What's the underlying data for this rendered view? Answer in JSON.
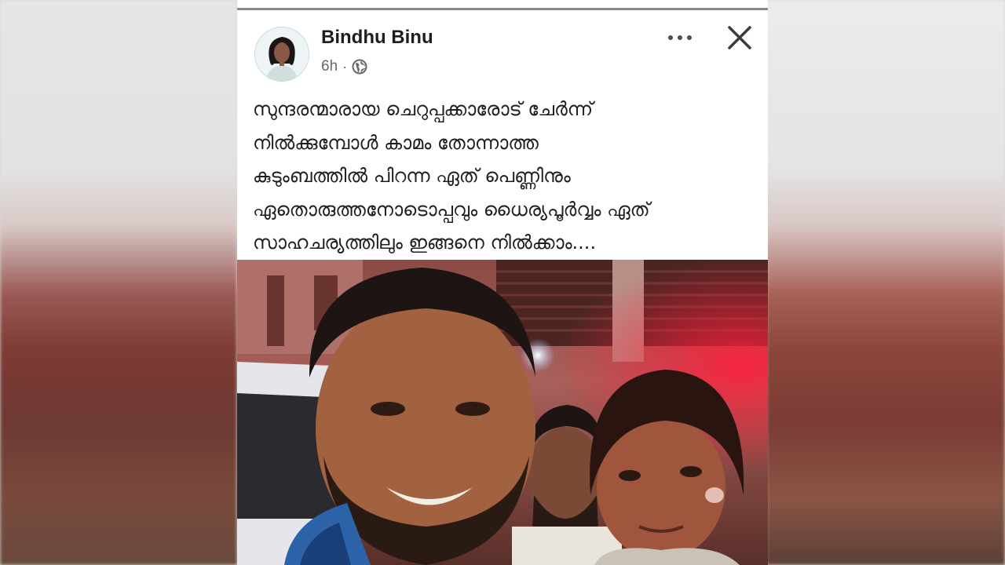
{
  "post": {
    "author_name": "Bindhu Binu",
    "timestamp": "6h",
    "separator": "·",
    "privacy_icon": "globe-icon",
    "more_icon": "more-horizontal-icon",
    "close_icon": "close-icon",
    "text_lines": [
      "സുന്ദരന്മാരായ ചെറുപ്പക്കാരോട് ചേർന്ന്",
      "നിൽക്കുമ്പോൾ കാമം തോന്നാത്ത",
      "കുടുംബത്തിൽ പിറന്ന ഏത് പെണ്ണിനും",
      "ഏതൊരുത്തനോടൊപ്പവും ധൈര്യപൂർവ്വം ഏത്",
      "സാഹചര്യത്തിലും ഇങ്ങനെ നിൽക്കാം...."
    ]
  },
  "colors": {
    "text_primary": "#1c1e21",
    "text_secondary": "#65676b",
    "card_background": "#ffffff"
  }
}
